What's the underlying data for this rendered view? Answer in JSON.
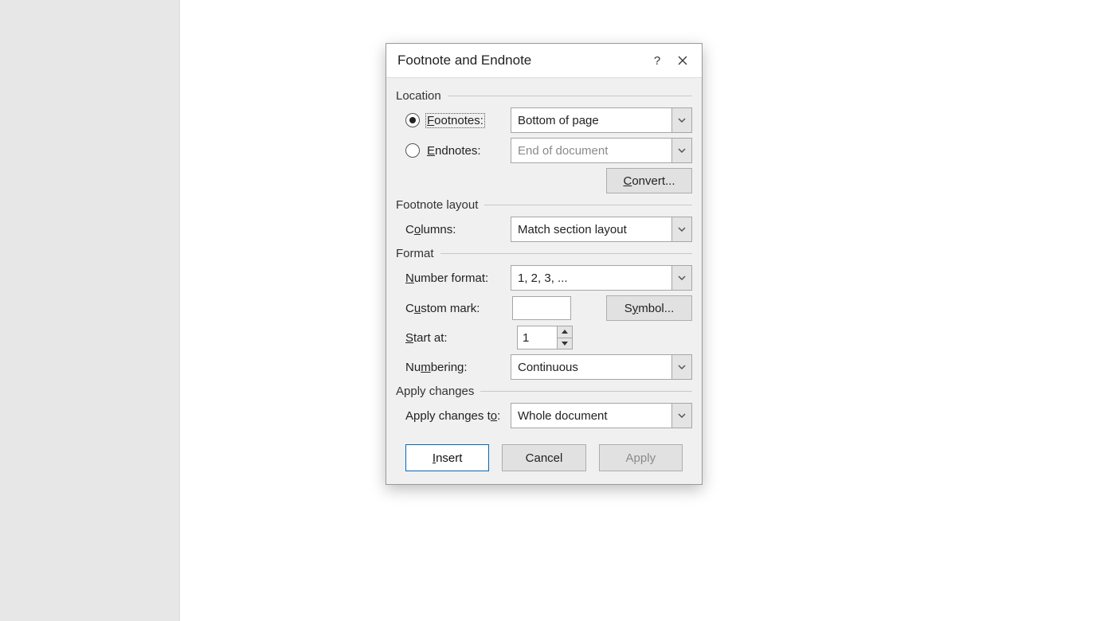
{
  "dialog": {
    "title": "Footnote and Endnote",
    "help_symbol": "?"
  },
  "groups": {
    "location": "Location",
    "footnote_layout": "Footnote layout",
    "format": "Format",
    "apply_changes": "Apply changes"
  },
  "location": {
    "footnotes_accel": "F",
    "footnotes_rest": "ootnotes:",
    "footnotes_value": "Bottom of page",
    "footnotes_checked": true,
    "endnotes_accel": "E",
    "endnotes_rest": "ndnotes:",
    "endnotes_value": "End of document",
    "convert_accel": "C",
    "convert_rest": "onvert..."
  },
  "layout": {
    "columns_pre": "C",
    "columns_accel": "o",
    "columns_rest": "lumns:",
    "columns_value": "Match section layout"
  },
  "format": {
    "number_format_accel": "N",
    "number_format_rest": "umber format:",
    "number_format_value": "1, 2, 3, ...",
    "custom_mark_pre": "C",
    "custom_mark_accel": "u",
    "custom_mark_rest": "stom mark:",
    "custom_mark_value": "",
    "symbol_pre": "S",
    "symbol_accel": "y",
    "symbol_rest": "mbol...",
    "start_at_accel": "S",
    "start_at_rest": "tart at:",
    "start_at_value": "1",
    "numbering_pre": "Nu",
    "numbering_accel": "m",
    "numbering_rest": "bering:",
    "numbering_value": "Continuous"
  },
  "apply": {
    "apply_to_pre": "Apply changes t",
    "apply_to_accel": "o",
    "apply_to_rest": ":",
    "apply_to_value": "Whole document"
  },
  "footer": {
    "insert_accel": "I",
    "insert_rest": "nsert",
    "cancel": "Cancel",
    "apply": "Apply"
  }
}
